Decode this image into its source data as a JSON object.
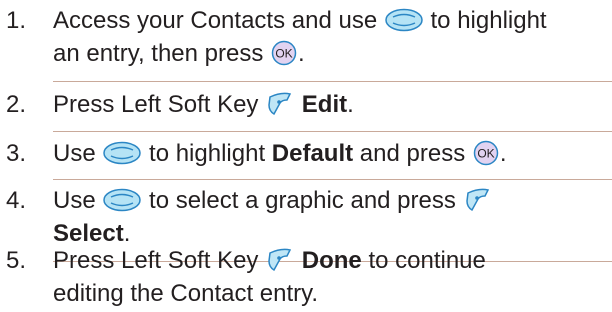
{
  "colors": {
    "text": "#231f20",
    "rule": "#c9a99a",
    "navkey_fill": "#b5e3f5",
    "icon_outline": "#2b86c4",
    "ok_fill": "#e2d3f1",
    "softkey_fill": "#bfe6f6"
  },
  "icons": {
    "nav": "navigation-key-icon",
    "ok": "ok-key-icon",
    "softkey": "left-soft-key-icon"
  },
  "steps": [
    {
      "number": "1.",
      "l1a": "Access your Contacts and use ",
      "l1b": " to highlight",
      "l2a": "an entry, then press ",
      "l2b": "."
    },
    {
      "number": "2.",
      "l1a": "Press Left Soft Key ",
      "l1bold": "Edit",
      "l1b": "."
    },
    {
      "number": "3.",
      "l1a": "Use ",
      "l1b": " to highlight ",
      "l1bold": "Default",
      "l1c": " and press ",
      "l1d": "."
    },
    {
      "number": "4.",
      "l1a": "Use ",
      "l1b": " to select a graphic and press ",
      "l2bold": "Select",
      "l2b": "."
    },
    {
      "number": "5.",
      "l1a": "Press Left Soft Key ",
      "l1bold": "Done",
      "l1b": " to continue",
      "l2a": "editing the Contact entry."
    }
  ]
}
